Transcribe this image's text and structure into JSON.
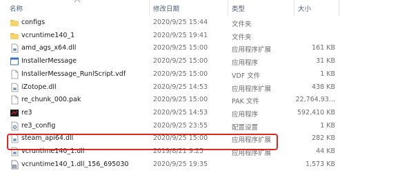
{
  "header": {
    "name": "名称",
    "date": "修改日期",
    "type": "类型",
    "size": "大小"
  },
  "files": [
    {
      "name": "configs",
      "date": "2020/9/25 15:44",
      "type": "文件夹",
      "size": "",
      "icon": "folder-icon"
    },
    {
      "name": "vcruntime140_1",
      "date": "2020/9/25 19:41",
      "type": "文件夹",
      "size": "",
      "icon": "folder-icon"
    },
    {
      "name": "amd_ags_x64.dll",
      "date": "2020/9/25 15:00",
      "type": "应用程序扩展",
      "size": "161 KB",
      "icon": "dll-file-icon"
    },
    {
      "name": "InstallerMessage",
      "date": "2020/9/25 15:00",
      "type": "应用程序",
      "size": "31 KB",
      "icon": "app-window-icon"
    },
    {
      "name": "InstallerMessage_RunlScript.vdf",
      "date": "2020/9/25 15:00",
      "type": "VDF 文件",
      "size": "1 KB",
      "icon": "blank-file-icon"
    },
    {
      "name": "iZotope.dll",
      "date": "2020/9/25 14:53",
      "type": "应用程序扩展",
      "size": "438 KB",
      "icon": "dll-file-icon"
    },
    {
      "name": "re_chunk_000.pak",
      "date": "2020/9/25 15:00",
      "type": "PAK 文件",
      "size": "22,764,93...",
      "icon": "blank-file-icon"
    },
    {
      "name": "re3",
      "date": "2020/9/25 14:53",
      "type": "应用程序",
      "size": "592,410 KB",
      "icon": "game-exe-icon"
    },
    {
      "name": "re3_config",
      "date": "2020/9/25 23:55",
      "type": "配置设置",
      "size": "1 KB",
      "icon": "config-file-icon"
    },
    {
      "name": "steam_api64.dll",
      "date": "2020/9/25 15:00",
      "type": "应用程序扩展",
      "size": "282 KB",
      "icon": "dll-file-icon"
    },
    {
      "name": "vcruntime140_1.dll",
      "date": "2019/8/21 9:25",
      "type": "应用程序扩展",
      "size": "44 KB",
      "icon": "dll-file-icon"
    },
    {
      "name": "vcruntime140_1.dll_156_695030",
      "date": "2020/9/25 19:35",
      "type": "",
      "size": "1,573 KB",
      "icon": "generic-file-icon"
    }
  ],
  "colors": {
    "highlight_border": "#e0241c",
    "folder": "#f0c44c",
    "header_text": "#4c607a"
  }
}
